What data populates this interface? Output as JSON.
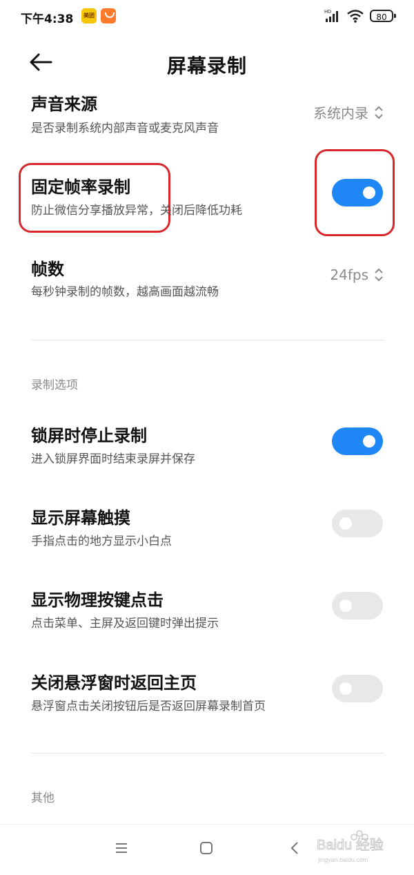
{
  "status_bar": {
    "time": "下午4:38",
    "meituan_badge": "美团",
    "network_badge": "HD",
    "battery": "80"
  },
  "header": {
    "title": "屏幕录制"
  },
  "settings": {
    "audio_source": {
      "title": "声音来源",
      "subtitle": "是否录制系统内部声音或麦克风声音",
      "value": "系统内录"
    },
    "fixed_framerate": {
      "title": "固定帧率录制",
      "subtitle": "防止微信分享播放异常，关闭后降低功耗",
      "enabled": true
    },
    "frame_rate": {
      "title": "帧数",
      "subtitle": "每秒钟录制的帧数，越高画面越流畅",
      "value": "24fps"
    }
  },
  "recording_options": {
    "section_label": "录制选项",
    "items": [
      {
        "title": "锁屏时停止录制",
        "subtitle": "进入锁屏界面时结束录屏并保存",
        "enabled": true
      },
      {
        "title": "显示屏幕触摸",
        "subtitle": "手指点击的地方显示小白点",
        "enabled": false
      },
      {
        "title": "显示物理按键点击",
        "subtitle": "点击菜单、主屏及返回键时弹出提示",
        "enabled": false
      },
      {
        "title": "关闭悬浮窗时返回主页",
        "subtitle": "悬浮窗点击关闭按钮后是否返回屏幕录制首页",
        "enabled": false
      }
    ]
  },
  "other_section": {
    "section_label": "其他"
  },
  "watermark": {
    "text": "Baidu 经验",
    "url": "jingyan.baidu.com"
  },
  "colors": {
    "accent": "#1e86f5",
    "annotation": "#d9262b",
    "toggle_off": "#e8e8e8"
  }
}
